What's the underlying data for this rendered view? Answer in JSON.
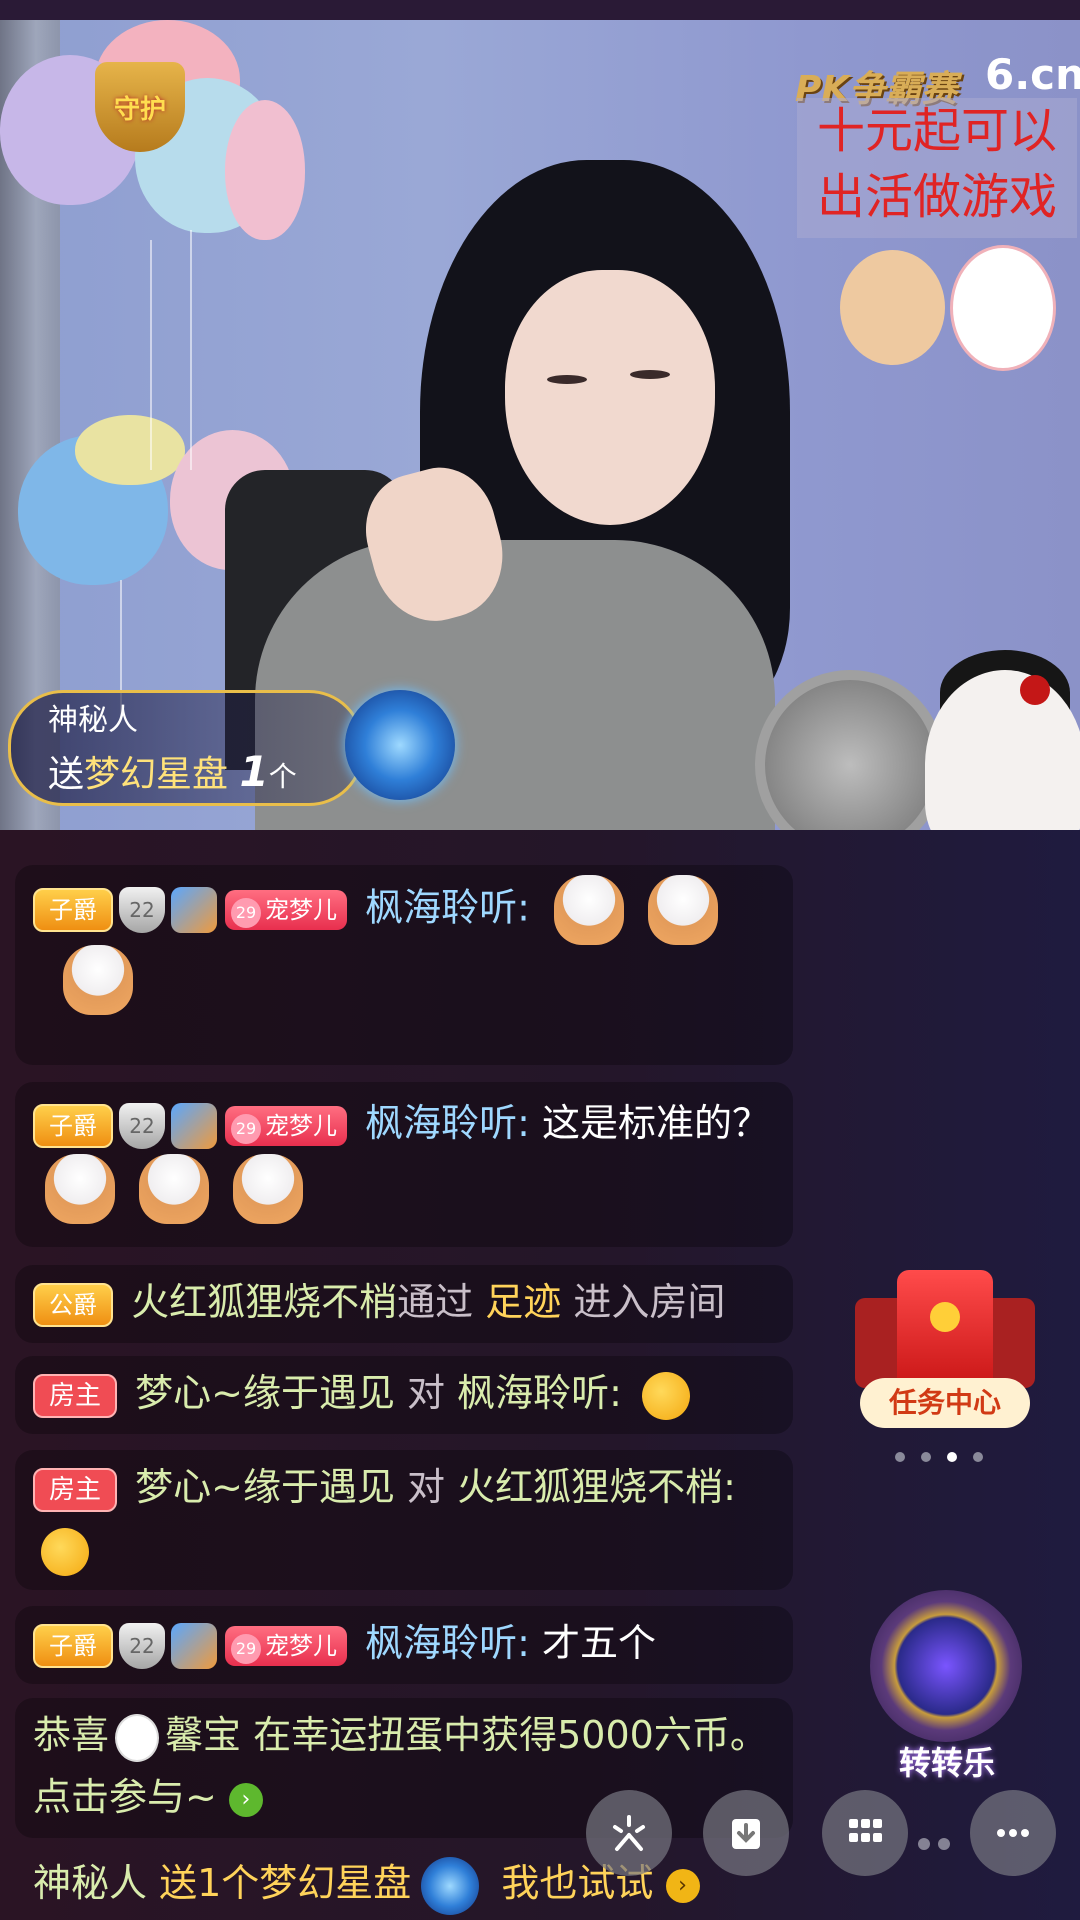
{
  "video": {
    "guard_badge": "守护",
    "pk_title": "PK争霸赛",
    "site_logo": "6.cn",
    "overlay_note": [
      "十元起可以",
      "出活做游戏"
    ],
    "gift_banner": {
      "sender": "神秘人",
      "action": "送",
      "gift_name": "梦幻星盘",
      "count": "1",
      "unit": "个"
    }
  },
  "chat": [
    {
      "rank": "子爵",
      "guard_level": "22",
      "club_level": "29",
      "club_name": "宠梦儿",
      "user": "枫海聆听:",
      "text": ""
    },
    {
      "rank": "子爵",
      "guard_level": "22",
      "club_level": "29",
      "club_name": "宠梦儿",
      "user": "枫海聆听:",
      "text": "这是标准的？"
    },
    {
      "rank": "公爵",
      "user": "火红狐狸烧不梢",
      "via": "通过",
      "source": "足迹",
      "action": "进入房间"
    },
    {
      "host_tag": "房主",
      "user": "梦心~缘于遇见",
      "to": "对",
      "target": "枫海聆听:"
    },
    {
      "host_tag": "房主",
      "user": "梦心~缘于遇见",
      "to": "对",
      "target": "火红狐狸烧不梢:"
    },
    {
      "rank": "子爵",
      "guard_level": "22",
      "club_level": "29",
      "club_name": "宠梦儿",
      "user": "枫海聆听:",
      "text": "才五个"
    },
    {
      "prefix": "恭喜",
      "user": "馨宝",
      "text": "在幸运扭蛋中获得5000六币。点击参与~"
    },
    {
      "user": "神秘人",
      "text": "送1个梦幻星盘",
      "cta": "我也试试"
    }
  ],
  "widgets": {
    "task_center": "任务中心",
    "spin": "转转乐"
  },
  "toolbar": {
    "icons": [
      "sparkle-icon",
      "download-icon",
      "grid-icon",
      "more-icon"
    ]
  },
  "colors": {
    "username_blue": "#9fd8ff",
    "gold": "#ffd35a",
    "host_red": "#f04c54"
  }
}
